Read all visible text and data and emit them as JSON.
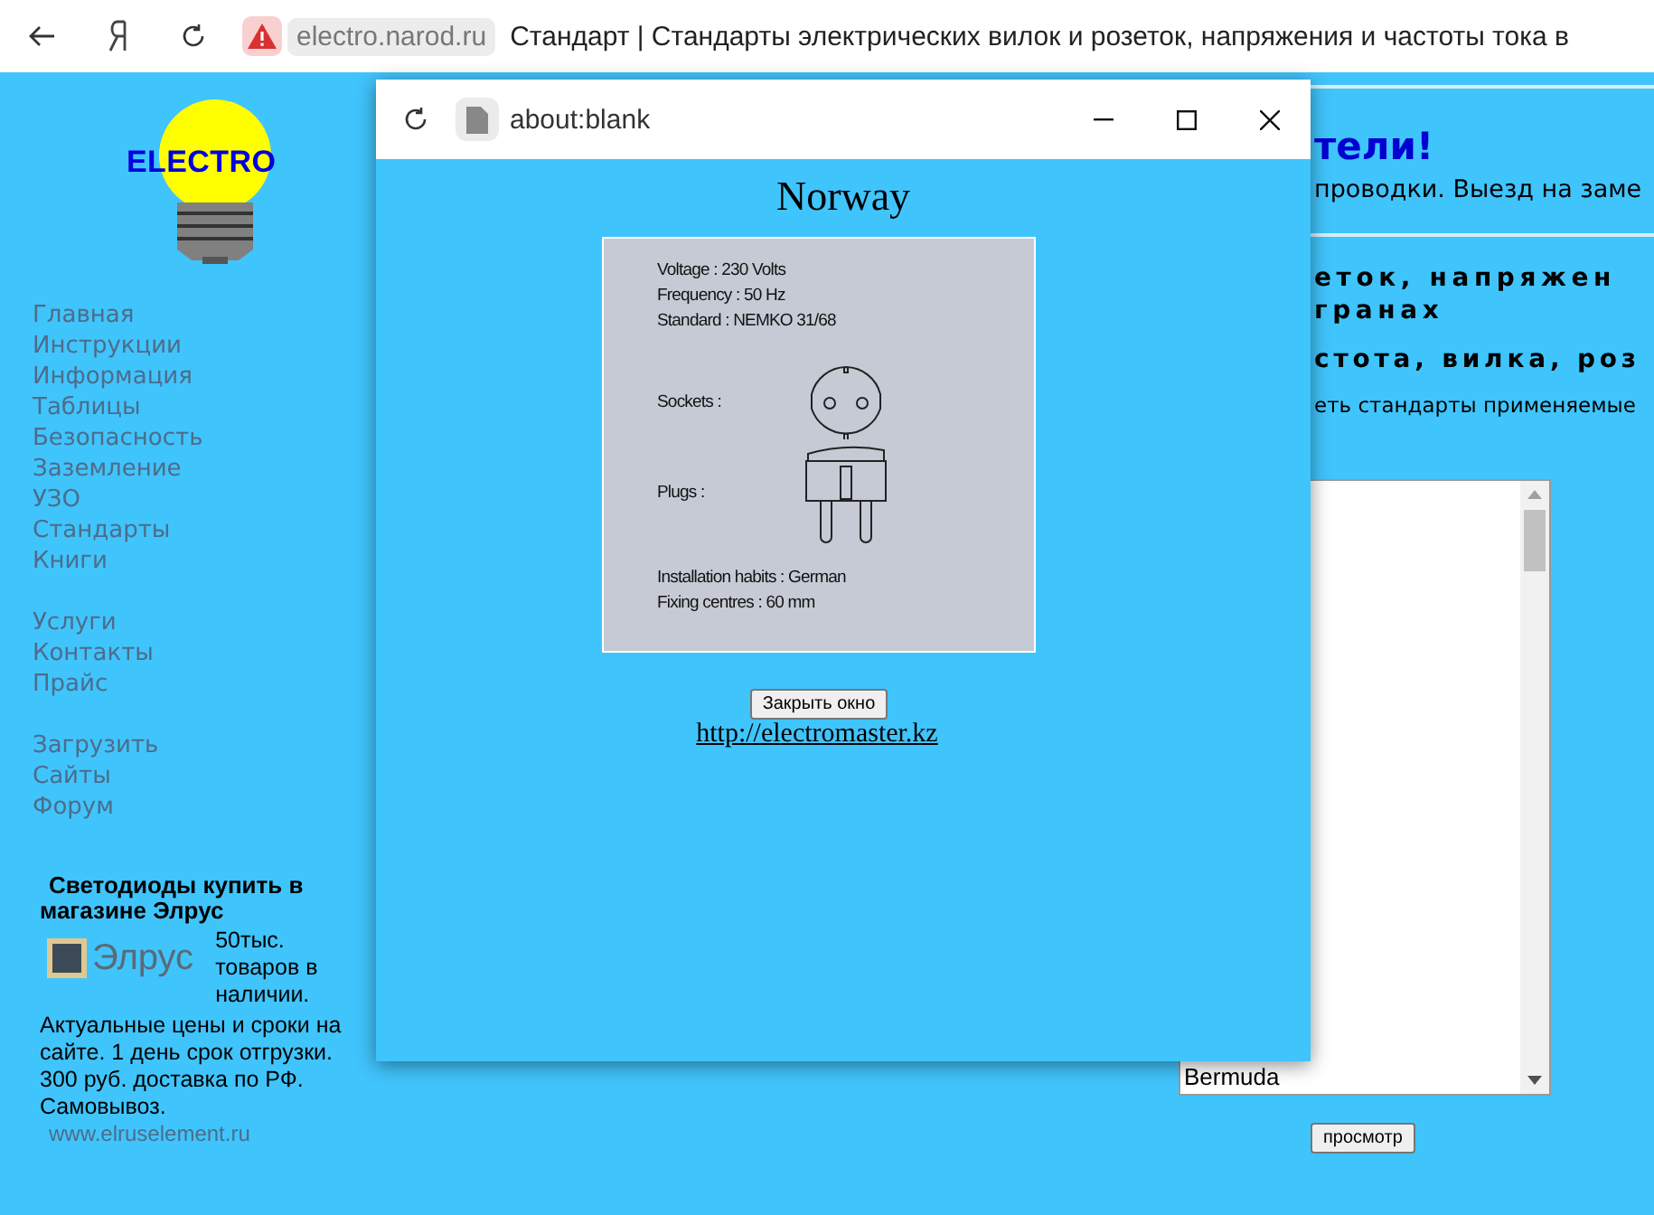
{
  "browser": {
    "site_label": "electro.narod.ru",
    "tab_title": "Стандарт | Стандарты электрических вилок и розеток, напряжения и частоты тока в"
  },
  "sidebar": {
    "logo_text": "ELECTRO",
    "nav_groups": [
      [
        "Главная",
        "Инструкции",
        "Информация",
        "Таблицы",
        "Безопасность",
        "Заземление",
        "УЗО",
        "Стандарты",
        "Книги"
      ],
      [
        "Услуги",
        "Контакты",
        "Прайс"
      ],
      [
        "Загрузить",
        "Сайты",
        "Форум"
      ]
    ],
    "ad": {
      "title": "Светодиоды купить в магазине Элрус",
      "logo_text": "Элрус",
      "stock": "50тыс. товаров в наличии.",
      "text": "Актуальные цены и сроки на сайте. 1 день срок отгрузки. 300 руб. доставка по РФ. Самовывоз.",
      "url": "www.elruselement.ru"
    }
  },
  "main": {
    "greeting": "тели!",
    "notice": "проводки. Выезд на заме",
    "heading_lines": [
      "еток, напряжен",
      "гранах"
    ],
    "subheading": "стота, вилка, роз",
    "intro": "еть стандарты применяемые",
    "country_list": [
      "Bermuda"
    ],
    "view_button": "просмотр"
  },
  "popup": {
    "address": "about:blank",
    "country": "Norway",
    "spec_top": [
      "Voltage : 230 Volts",
      "Frequency : 50 Hz",
      "Standard : NEMKO 31/68"
    ],
    "sockets_label": "Sockets :",
    "plugs_label": "Plugs :",
    "spec_bottom": [
      "Installation habits : German",
      "Fixing centres : 60 mm"
    ],
    "close_button": "Закрыть окно",
    "link": "http://electromaster.kz"
  }
}
